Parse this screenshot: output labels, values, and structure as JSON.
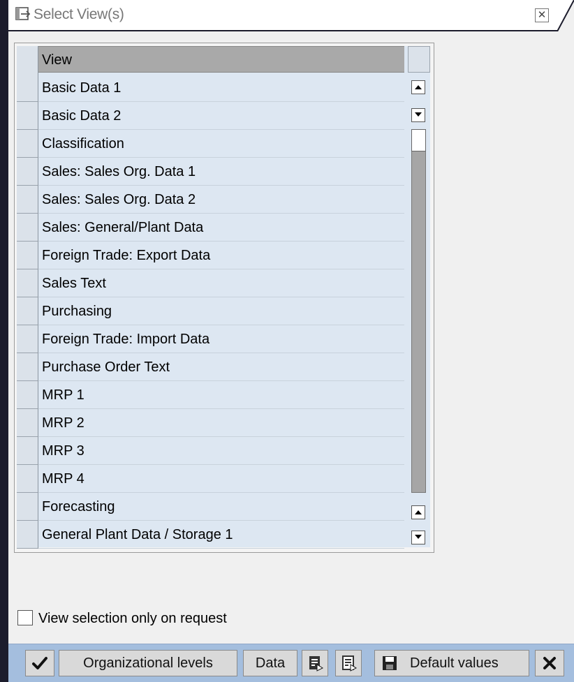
{
  "window": {
    "title": "Select View(s)",
    "close_symbol": "✕"
  },
  "table": {
    "header": "View",
    "rows": [
      "Basic Data 1",
      "Basic Data 2",
      "Classification",
      "Sales: Sales Org. Data 1",
      "Sales: Sales Org. Data 2",
      "Sales: General/Plant Data",
      "Foreign Trade: Export Data",
      "Sales Text",
      "Purchasing",
      "Foreign Trade: Import Data",
      "Purchase Order Text",
      "MRP 1",
      "MRP 2",
      "MRP 3",
      "MRP 4",
      "Forecasting",
      "General Plant Data / Storage 1"
    ]
  },
  "options": {
    "view_selection_label": "View selection only on request",
    "view_selection_checked": false
  },
  "toolbar": {
    "org_levels_label": "Organizational levels",
    "data_label": "Data",
    "default_values_label": "Default values"
  },
  "colors": {
    "row_background": "#dde7f2",
    "header_background": "#a9a9a9",
    "toolbar_background": "#a4bede"
  },
  "icons": {
    "title": "window-select-icon",
    "confirm": "checkmark-icon",
    "select_all": "select-all-icon",
    "deselect_all": "deselect-all-icon",
    "save": "save-icon",
    "cancel": "cancel-icon"
  }
}
